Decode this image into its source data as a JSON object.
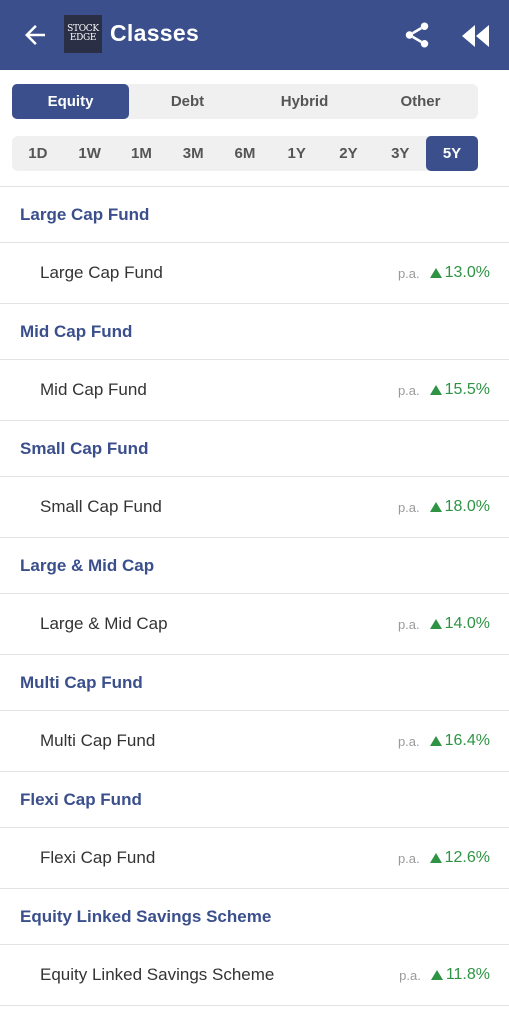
{
  "header": {
    "title": "Classes",
    "logo_line1": "STOCK",
    "logo_line2": "EDGE",
    "bg_color": "#3a4f8c",
    "back_icon": "arrow-left-icon",
    "share_icon": "share-icon",
    "rewind_icon": "rewind-icon"
  },
  "asset_tabs": [
    {
      "label": "Equity",
      "active": true
    },
    {
      "label": "Debt",
      "active": false
    },
    {
      "label": "Hybrid",
      "active": false
    },
    {
      "label": "Other",
      "active": false
    }
  ],
  "periods": [
    {
      "label": "1D",
      "active": false
    },
    {
      "label": "1W",
      "active": false
    },
    {
      "label": "1M",
      "active": false
    },
    {
      "label": "3M",
      "active": false
    },
    {
      "label": "6M",
      "active": false
    },
    {
      "label": "1Y",
      "active": false
    },
    {
      "label": "2Y",
      "active": false
    },
    {
      "label": "3Y",
      "active": false
    },
    {
      "label": "5Y",
      "active": true
    }
  ],
  "categories": [
    {
      "header": "Large Cap Fund",
      "name": "Large Cap Fund",
      "pa": "p.a.",
      "return": "13.0%"
    },
    {
      "header": "Mid Cap Fund",
      "name": "Mid Cap Fund",
      "pa": "p.a.",
      "return": "15.5%"
    },
    {
      "header": "Small Cap Fund",
      "name": "Small Cap Fund",
      "pa": "p.a.",
      "return": "18.0%"
    },
    {
      "header": "Large & Mid Cap",
      "name": "Large & Mid Cap",
      "pa": "p.a.",
      "return": "14.0%"
    },
    {
      "header": "Multi Cap Fund",
      "name": "Multi Cap Fund",
      "pa": "p.a.",
      "return": "16.4%"
    },
    {
      "header": "Flexi Cap Fund",
      "name": "Flexi Cap Fund",
      "pa": "p.a.",
      "return": "12.6%"
    },
    {
      "header": "Equity Linked Savings Scheme",
      "name": "Equity Linked Savings Scheme",
      "pa": "p.a.",
      "return": "11.8%"
    }
  ],
  "colors": {
    "accent": "#3a4f8c",
    "positive": "#2e9444",
    "muted": "#9a9a9a"
  }
}
